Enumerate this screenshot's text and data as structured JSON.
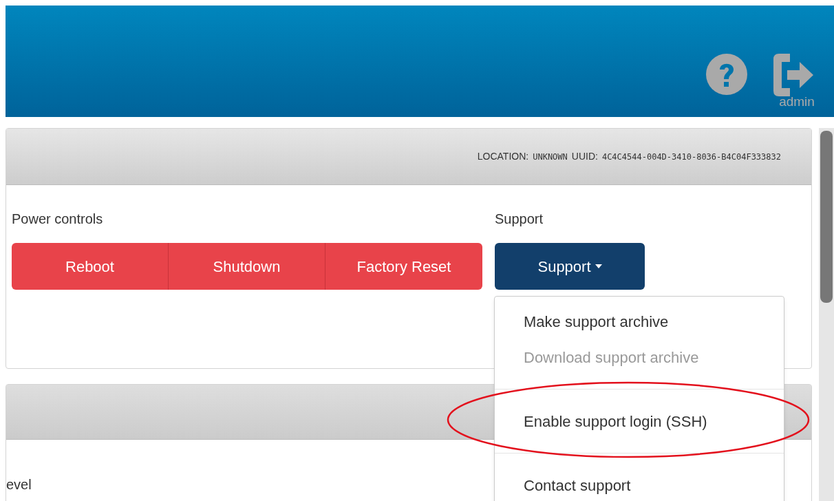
{
  "header": {
    "user": "admin"
  },
  "info_bar": {
    "location_label": "LOCATION:",
    "location": "UNKNOWN",
    "uuid_label": "UUID:",
    "uuid": "4C4C4544-004D-3410-8036-B4C04F333832"
  },
  "power_controls": {
    "title": "Power controls",
    "buttons": [
      "Reboot",
      "Shutdown",
      "Factory Reset"
    ]
  },
  "support": {
    "title": "Support",
    "button": "Support",
    "menu": [
      {
        "kind": "item",
        "label": "Make support archive",
        "disabled": false
      },
      {
        "kind": "item",
        "label": "Download support archive",
        "disabled": true
      },
      {
        "kind": "divider"
      },
      {
        "kind": "item",
        "label": "Enable support login (SSH)",
        "disabled": false
      },
      {
        "kind": "divider"
      },
      {
        "kind": "item",
        "label": "Contact support",
        "disabled": false
      }
    ]
  },
  "second_panel": {
    "label": "evel"
  }
}
